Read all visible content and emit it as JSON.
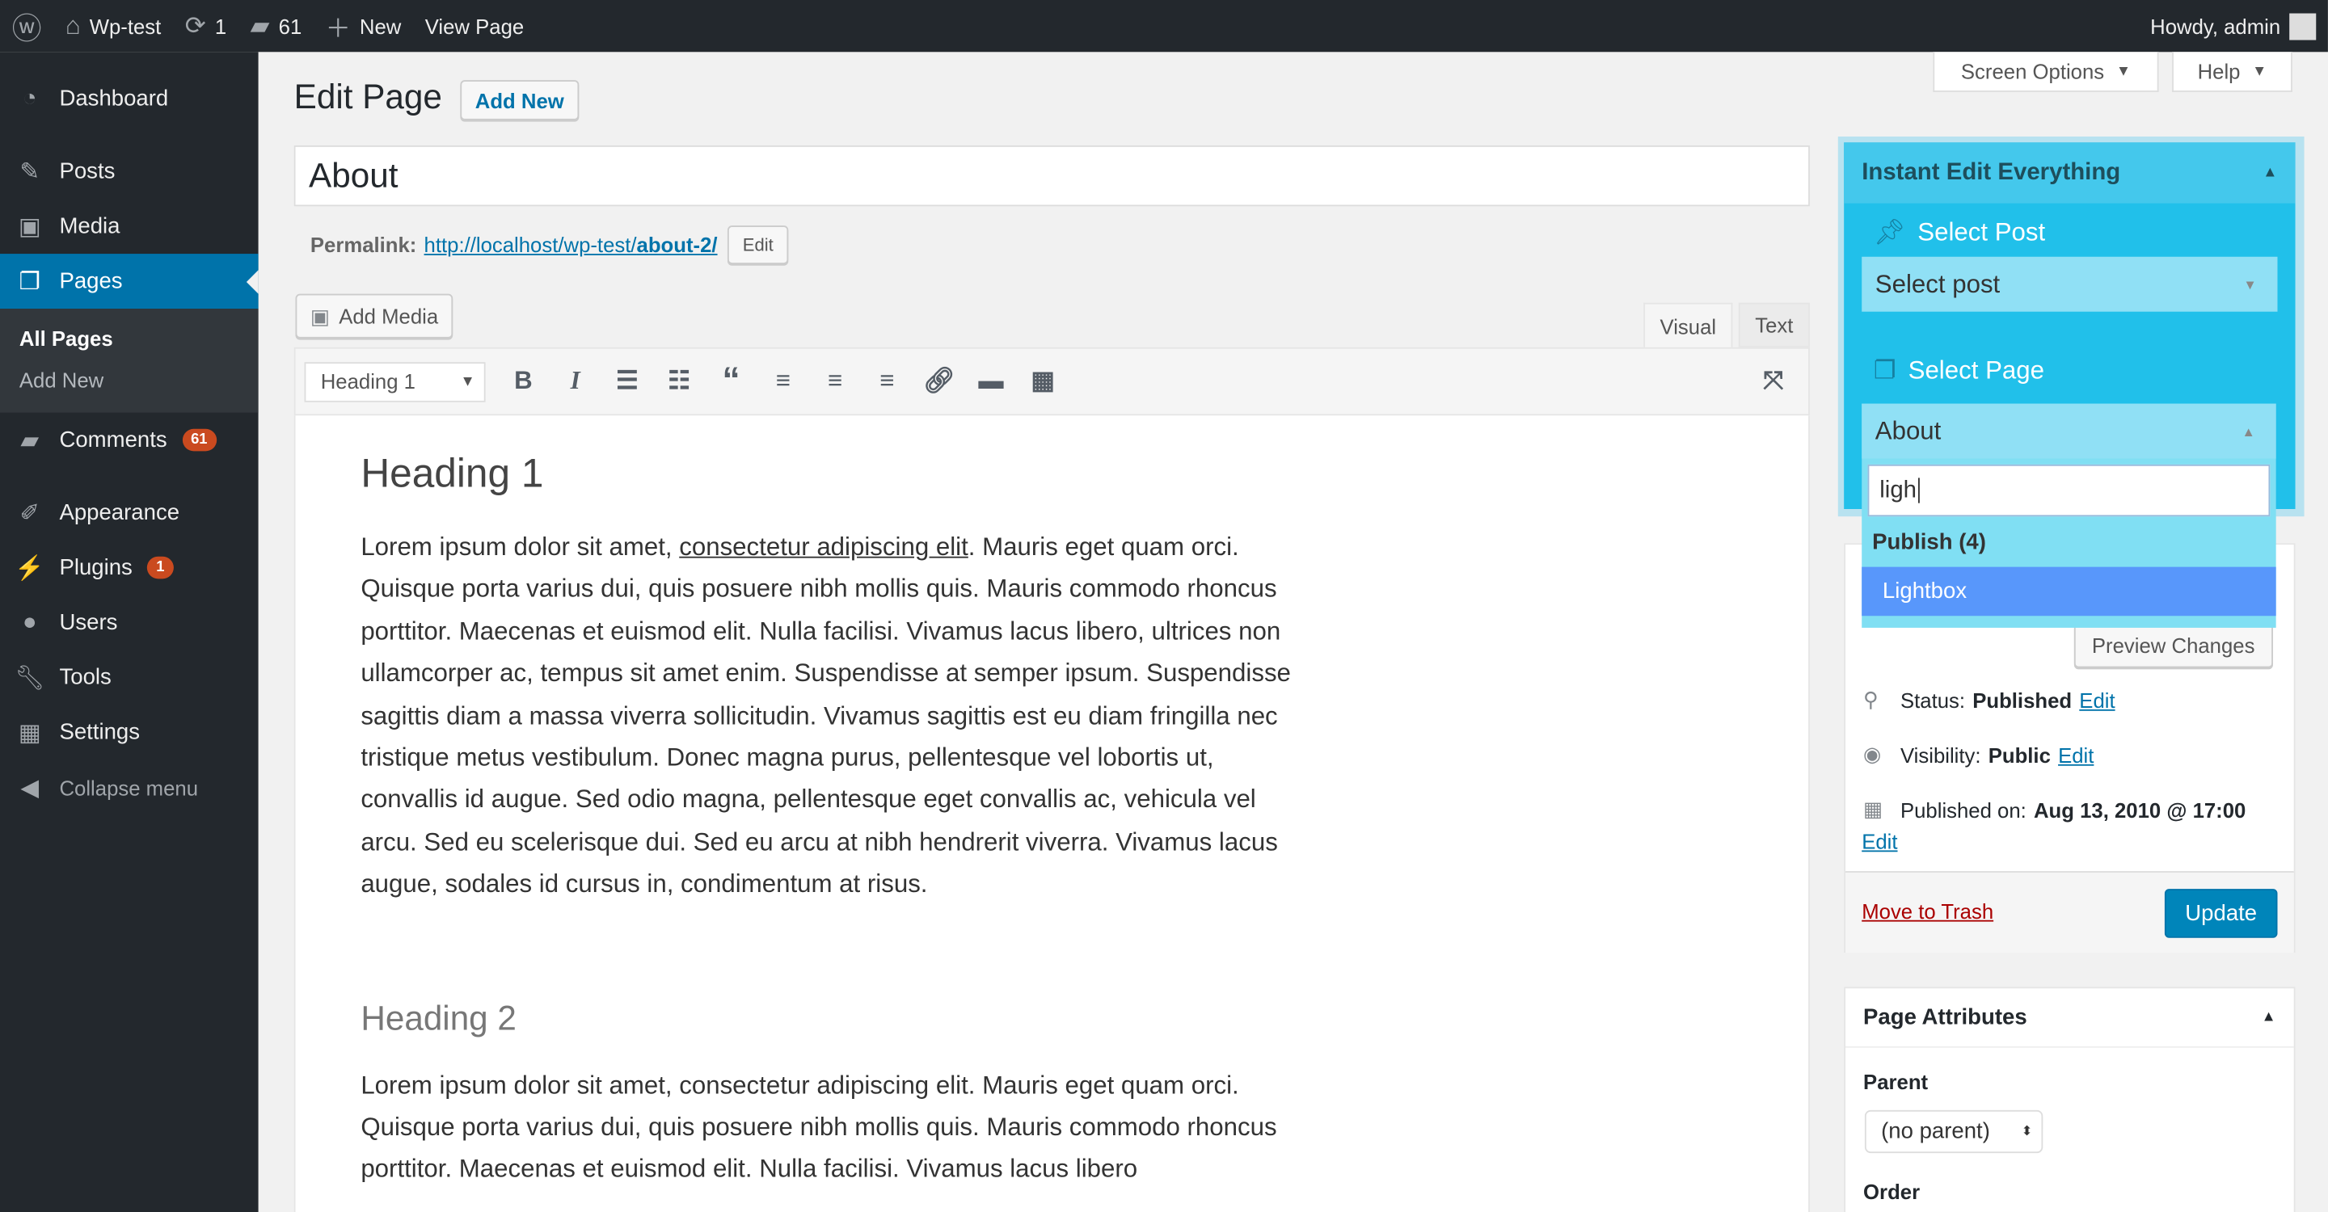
{
  "adminbar": {
    "site": "Wp-test",
    "updates": "1",
    "comments": "61",
    "new": "New",
    "view": "View Page",
    "howdy": "Howdy, admin"
  },
  "sidebar": {
    "items": [
      {
        "label": "Dashboard",
        "icon": "dashboard-icon"
      },
      {
        "label": "Posts",
        "icon": "pin-icon"
      },
      {
        "label": "Media",
        "icon": "media-icon"
      },
      {
        "label": "Pages",
        "icon": "pages-icon"
      },
      {
        "label": "Comments",
        "icon": "comment-icon",
        "badge": "61"
      },
      {
        "label": "Appearance",
        "icon": "brush-icon"
      },
      {
        "label": "Plugins",
        "icon": "plugin-icon",
        "badge": "1"
      },
      {
        "label": "Users",
        "icon": "user-icon"
      },
      {
        "label": "Tools",
        "icon": "wrench-icon"
      },
      {
        "label": "Settings",
        "icon": "settings-icon"
      },
      {
        "label": "Collapse menu",
        "icon": "collapse-icon"
      }
    ],
    "sub": [
      "All Pages",
      "Add New"
    ]
  },
  "header": {
    "title": "Edit Page",
    "add_new": "Add New",
    "screen_options": "Screen Options",
    "help": "Help"
  },
  "editor": {
    "title": "About",
    "permalink_label": "Permalink:",
    "permalink_base": "http://localhost/wp-test/",
    "permalink_slug": "about-2/",
    "edit": "Edit",
    "add_media": "Add Media",
    "tab_visual": "Visual",
    "tab_text": "Text",
    "format": "Heading 1",
    "h1": "Heading 1",
    "p1_a": "Lorem ipsum dolor sit amet, ",
    "p1_link": "consectetur adipiscing elit",
    "p1_b": ". Mauris eget quam orci. Quisque porta varius dui, quis posuere nibh mollis quis. Mauris commodo rhoncus porttitor. Maecenas et euismod elit. Nulla facilisi. Vivamus lacus libero, ultrices non ullamcorper ac, tempus sit amet enim. Suspendisse at semper ipsum. Suspendisse sagittis diam a massa viverra sollicitudin. Vivamus sagittis est eu diam fringilla nec tristique metus vestibulum. Donec magna purus, pellentesque vel lobortis ut, convallis id augue. Sed odio magna, pellentesque eget convallis ac, vehicula vel arcu. Sed eu scelerisque dui. Sed eu arcu at nibh hendrerit viverra. Vivamus lacus augue, sodales id cursus in, condimentum at risus.",
    "h2": "Heading 2",
    "p2": "Lorem ipsum dolor sit amet, consectetur adipiscing elit. Mauris eget quam orci. Quisque porta varius dui, quis posuere nibh mollis quis. Mauris commodo rhoncus porttitor. Maecenas et euismod elit. Nulla facilisi. Vivamus lacus libero"
  },
  "instant": {
    "title": "Instant Edit Everything",
    "select_post": "Select Post",
    "post_placeholder": "Select post",
    "select_page": "Select Page",
    "page_value": "About",
    "search": "ligh",
    "group": "Publish (4)",
    "option": "Lightbox",
    "colors": {
      "panel": "#21c0ea",
      "header": "#44c8ec",
      "select": "#90e0f5",
      "highlight": "#5897fb"
    }
  },
  "publish": {
    "preview": "Preview Changes",
    "status_label": "Status:",
    "status": "Published",
    "visibility_label": "Visibility:",
    "visibility": "Public",
    "published_label": "Published on:",
    "published": "Aug 13, 2010 @ 17:00",
    "edit": "Edit",
    "trash": "Move to Trash",
    "update": "Update"
  },
  "attributes": {
    "title": "Page Attributes",
    "parent_label": "Parent",
    "parent": "(no parent)",
    "order_label": "Order"
  }
}
